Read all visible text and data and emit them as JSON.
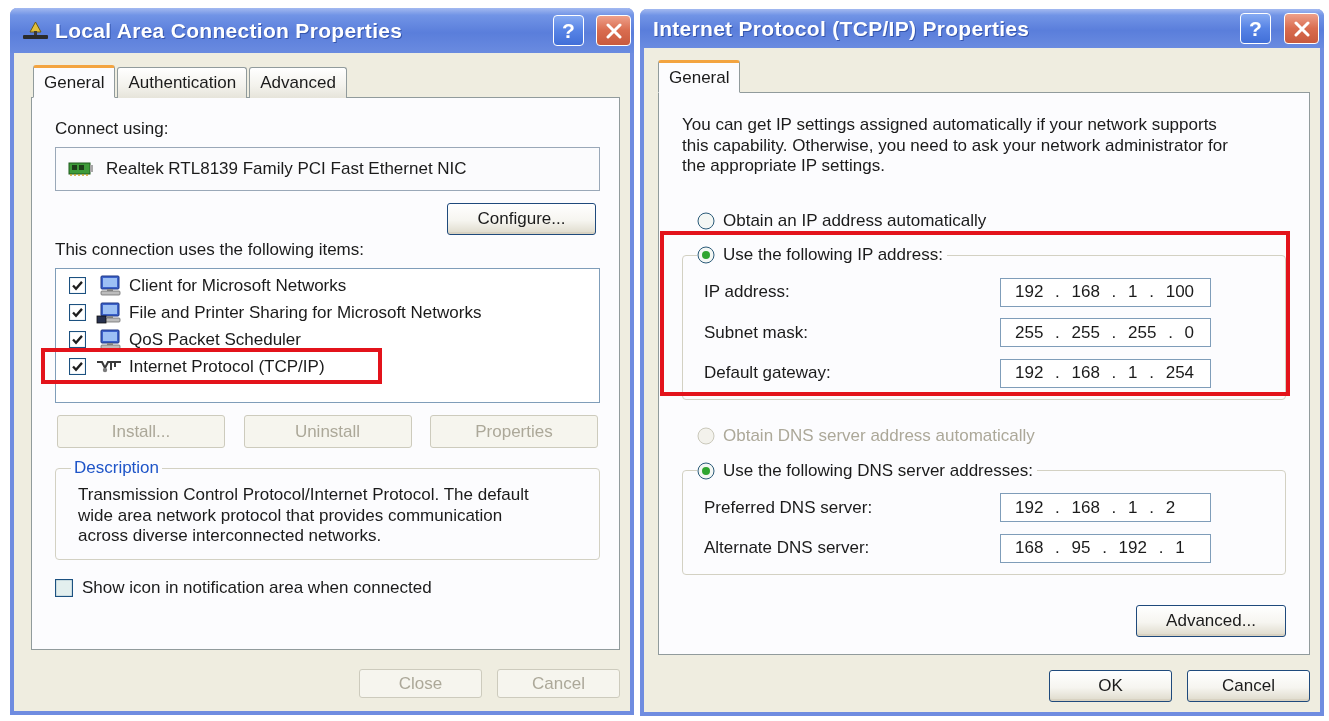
{
  "connection_dialog": {
    "title": "Local Area Connection Properties",
    "title_buttons": [
      {
        "kind": "help",
        "label": "?"
      },
      {
        "kind": "close"
      }
    ],
    "tabs": [
      {
        "label": "General",
        "selected": true
      },
      {
        "label": "Authentication",
        "selected": false
      },
      {
        "label": "Advanced",
        "selected": false
      }
    ],
    "connect_using": {
      "label": "Connect using:",
      "adapter": "Realtek RTL8139 Family PCI Fast Ethernet NIC",
      "button": "Configure..."
    },
    "items": {
      "label": "This connection uses the following items:",
      "entries": [
        {
          "label": "Client for Microsoft Networks",
          "kind": "client",
          "checked": true,
          "highlighted": false
        },
        {
          "label": "File and Printer Sharing for Microsoft Networks",
          "kind": "service",
          "checked": true,
          "highlighted": false
        },
        {
          "label": "QoS Packet Scheduler",
          "kind": "scheduler",
          "checked": true,
          "highlighted": false
        },
        {
          "label": "Internet Protocol (TCP/IP)",
          "kind": "protocol",
          "checked": true,
          "highlighted": true
        }
      ]
    },
    "item_buttons": [
      {
        "label": "Install...",
        "disabled": true
      },
      {
        "label": "Uninstall",
        "disabled": true
      },
      {
        "label": "Properties",
        "disabled": true
      }
    ],
    "description": {
      "title": "Description",
      "text": "Transmission Control Protocol/Internet Protocol. The default wide area network protocol that provides communication across diverse interconnected networks."
    },
    "notify": {
      "label": "Show icon in notification area when connected",
      "checked": false
    },
    "buttons": [
      {
        "label": "Close",
        "disabled": true
      },
      {
        "label": "Cancel",
        "disabled": true
      }
    ]
  },
  "tcpip_dialog": {
    "title": "Internet Protocol (TCP/IP) Properties",
    "title_buttons": [
      {
        "kind": "help",
        "label": "?"
      },
      {
        "kind": "close"
      }
    ],
    "tabs": [
      {
        "label": "General",
        "selected": true
      }
    ],
    "intro": "You can get IP settings assigned automatically if your network supports this capability. Otherwise, you need to ask your network administrator for the appropriate IP settings.",
    "ip_settings": {
      "highlighted": true,
      "options": [
        {
          "label": "Obtain an IP address automatically",
          "selected": false,
          "disabled": false
        },
        {
          "label": "Use the following IP address:",
          "selected": true,
          "disabled": false
        }
      ],
      "fields": [
        {
          "label": "IP address:",
          "value": "192 . 168 . 1 . 100"
        },
        {
          "label": "Subnet mask:",
          "value": "255 . 255 . 255 . 0"
        },
        {
          "label": "Default gateway:",
          "value": "192 . 168 . 1 . 254"
        }
      ]
    },
    "dns_settings": {
      "options": [
        {
          "label": "Obtain DNS server address automatically",
          "selected": false,
          "disabled": true
        },
        {
          "label": "Use the following DNS server addresses:",
          "selected": true,
          "disabled": false
        }
      ],
      "fields": [
        {
          "label": "Preferred DNS server:",
          "value": "192 . 168 . 1 . 2"
        },
        {
          "label": "Alternate DNS server:",
          "value": "168 . 95 . 192 . 1"
        }
      ]
    },
    "advanced_button": "Advanced...",
    "buttons": [
      {
        "label": "OK",
        "disabled": false
      },
      {
        "label": "Cancel",
        "disabled": false
      }
    ]
  }
}
